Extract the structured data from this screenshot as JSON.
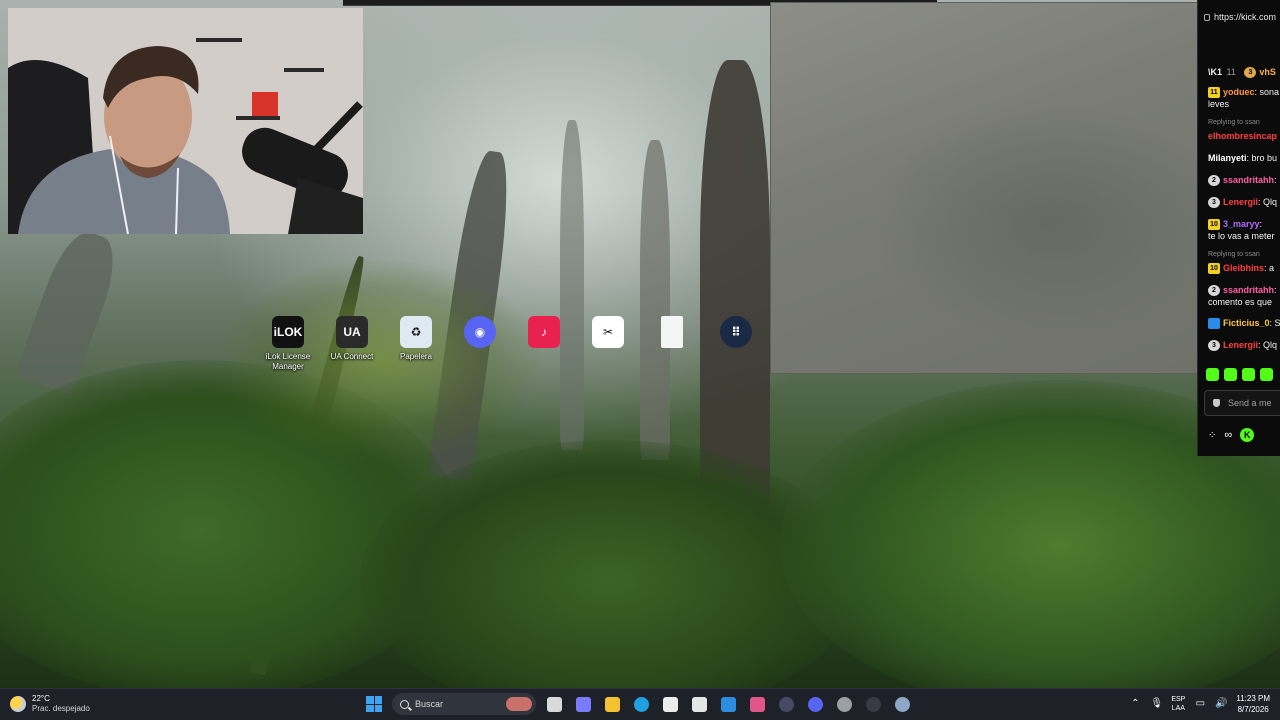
{
  "browser": {
    "url": "https://kick.com"
  },
  "desktop_icons": [
    {
      "label": "iLok License\nManager",
      "icon": "ilok-icon",
      "glyph": "iLOK",
      "color": "#111111"
    },
    {
      "label": "UA Connect",
      "icon": "ua-connect-icon",
      "glyph": "UA",
      "color": "#2a2a2a"
    },
    {
      "label": "Papelera",
      "icon": "recycle-bin-icon",
      "glyph": "♻",
      "color": "#dfe9f2"
    },
    {
      "label": "",
      "icon": "discord-icon",
      "glyph": "◉",
      "color": "#5865f2"
    },
    {
      "label": "",
      "icon": "tiktok-live-icon",
      "glyph": "♪",
      "color": "#e8214f"
    },
    {
      "label": "",
      "icon": "capcut-icon",
      "glyph": "✂",
      "color": "#ffffff"
    },
    {
      "label": "",
      "icon": "blank-file-icon",
      "glyph": "",
      "color": "#f5f5f5"
    },
    {
      "label": "",
      "icon": "app-grid-icon",
      "glyph": "⠿",
      "color": "#1b2a44"
    }
  ],
  "chat": {
    "header": {
      "left": "\\K1",
      "left_count": "11",
      "right_badge": "3",
      "right_user": "vhS"
    },
    "messages": [
      {
        "badge": "11",
        "badge_style": "yel",
        "user": "yoduec",
        "user_color": "#ff9b3d",
        "text": ": sona",
        "continuation": "leves"
      },
      {
        "reply_note": "Replying to ssan",
        "user": "elhombresincap",
        "user_color": "#ff4040",
        "text": ""
      },
      {
        "badge": "",
        "user": "Milanyeti",
        "user_color": "#ffffff",
        "text": ": bro bu"
      },
      {
        "badge": "2",
        "badge_style": "round",
        "user": "ssandritahh",
        "user_color": "#ff5fa2",
        "text": ":"
      },
      {
        "badge": "3",
        "badge_style": "round",
        "user": "Lenergii",
        "user_color": "#ff4040",
        "text": ": Qlq"
      },
      {
        "badge": "10",
        "badge_style": "yel",
        "user": "3_maryy",
        "user_color": "#b06cff",
        "text": ":",
        "continuation": "te lo vas a meter"
      },
      {
        "reply_note": "Replying to ssan",
        "badge": "10",
        "badge_style": "yel",
        "user": "Gleibhins",
        "user_color": "#ff4040",
        "text": ": a"
      },
      {
        "badge": "2",
        "badge_style": "round",
        "user": "ssandritahh",
        "user_color": "#ff5fa2",
        "text": ":",
        "continuation": "comento es que"
      },
      {
        "badge": "",
        "badge_style": "blue",
        "user": "Ficticius_0",
        "user_color": "#ffc83d",
        "text": ": S"
      },
      {
        "badge": "3",
        "badge_style": "round",
        "user": "Lenergii",
        "user_color": "#ff4040",
        "text": ": Qlq"
      }
    ],
    "send_placeholder": "Send a me",
    "bottom_infinity": "∞",
    "bottom_k": "K"
  },
  "taskbar": {
    "weather": {
      "temp": "22°C",
      "desc": "Prac. despejado"
    },
    "search_placeholder": "Buscar",
    "apps": [
      {
        "icon": "task-view-icon",
        "color": "#d9d9d9"
      },
      {
        "icon": "copilot-icon",
        "color": "#7a7cff"
      },
      {
        "icon": "file-explorer-icon",
        "color": "#f2c230"
      },
      {
        "icon": "edge-icon",
        "color": "#1fa0e0"
      },
      {
        "icon": "store-icon",
        "color": "#ececec"
      },
      {
        "icon": "alien-app-icon",
        "color": "#e6e6e6"
      },
      {
        "icon": "mail-icon",
        "color": "#2d8ee0"
      },
      {
        "icon": "copilot-app-icon",
        "color": "#e0568a"
      },
      {
        "icon": "keyboard-app-icon",
        "color": "#454a66"
      },
      {
        "icon": "discord-taskbar-icon",
        "color": "#5865f2"
      },
      {
        "icon": "chrome-icon",
        "color": "#9aa0a6"
      },
      {
        "icon": "media-player-icon",
        "color": "#3a3a44"
      },
      {
        "icon": "settings-icon",
        "color": "#8ea7c6"
      }
    ],
    "lang": {
      "line1": "ESP",
      "line2": "LAA"
    },
    "clock": {
      "time": "11:23 PM",
      "date": "8/7/2026"
    }
  }
}
